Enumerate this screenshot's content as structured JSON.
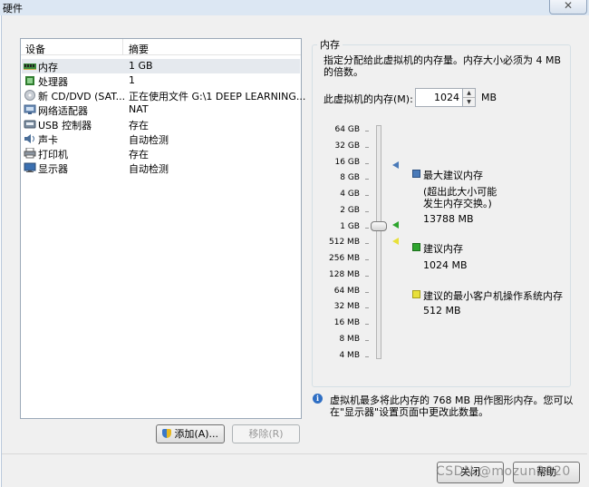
{
  "window": {
    "title": "硬件",
    "close_icon": "close-icon"
  },
  "hardware": {
    "col_device": "设备",
    "col_summary": "摘要",
    "items": [
      {
        "device": "内存",
        "summary": "1 GB",
        "icon": "memory-icon"
      },
      {
        "device": "处理器",
        "summary": "1",
        "icon": "cpu-icon"
      },
      {
        "device": "新 CD/DVD (SAT...",
        "summary": "正在使用文件 G:\\1 DEEP LEARNING...",
        "icon": "cd-dvd-icon"
      },
      {
        "device": "网络适配器",
        "summary": "NAT",
        "icon": "network-icon"
      },
      {
        "device": "USB 控制器",
        "summary": "存在",
        "icon": "usb-icon"
      },
      {
        "device": "声卡",
        "summary": "自动检测",
        "icon": "sound-icon"
      },
      {
        "device": "打印机",
        "summary": "存在",
        "icon": "printer-icon"
      },
      {
        "device": "显示器",
        "summary": "自动检测",
        "icon": "display-icon"
      }
    ],
    "add_button": "添加(A)...",
    "remove_button": "移除(R)"
  },
  "memory": {
    "group_title": "内存",
    "description": "指定分配给此虚拟机的内存量。内存大小必须为 4 MB 的倍数。",
    "field_label": "此虚拟机的内存(M):",
    "value": "1024",
    "unit": "MB",
    "scale": [
      "64 GB",
      "32 GB",
      "16 GB",
      "8 GB",
      "4 GB",
      "2 GB",
      "1 GB",
      "512 MB",
      "256 MB",
      "128 MB",
      "64 MB",
      "32 MB",
      "16 MB",
      "8 MB",
      "4 MB"
    ],
    "slider_value": "1 GB",
    "legend": {
      "max_label": "最大建议内存",
      "max_note": "(超出此大小可能发生内存交换。)",
      "max_value": "13788 MB",
      "rec_label": "建议内存",
      "rec_value": "1024 MB",
      "min_label": "建议的最小客户机操作系统内存",
      "min_value": "512 MB"
    },
    "colors": {
      "max": "#4a7ab8",
      "rec": "#2ea52e",
      "min": "#e8e03a"
    }
  },
  "info": {
    "icon": "info-icon",
    "text_line1": "虚拟机最多将此内存的 768 MB 用作图形内存。您可以",
    "text_line2": "在\"显示器\"设置页面中更改此数量。"
  },
  "footer": {
    "close_button": "关闭",
    "help_button": "帮助",
    "watermark": "CSDN @mozun2020"
  }
}
